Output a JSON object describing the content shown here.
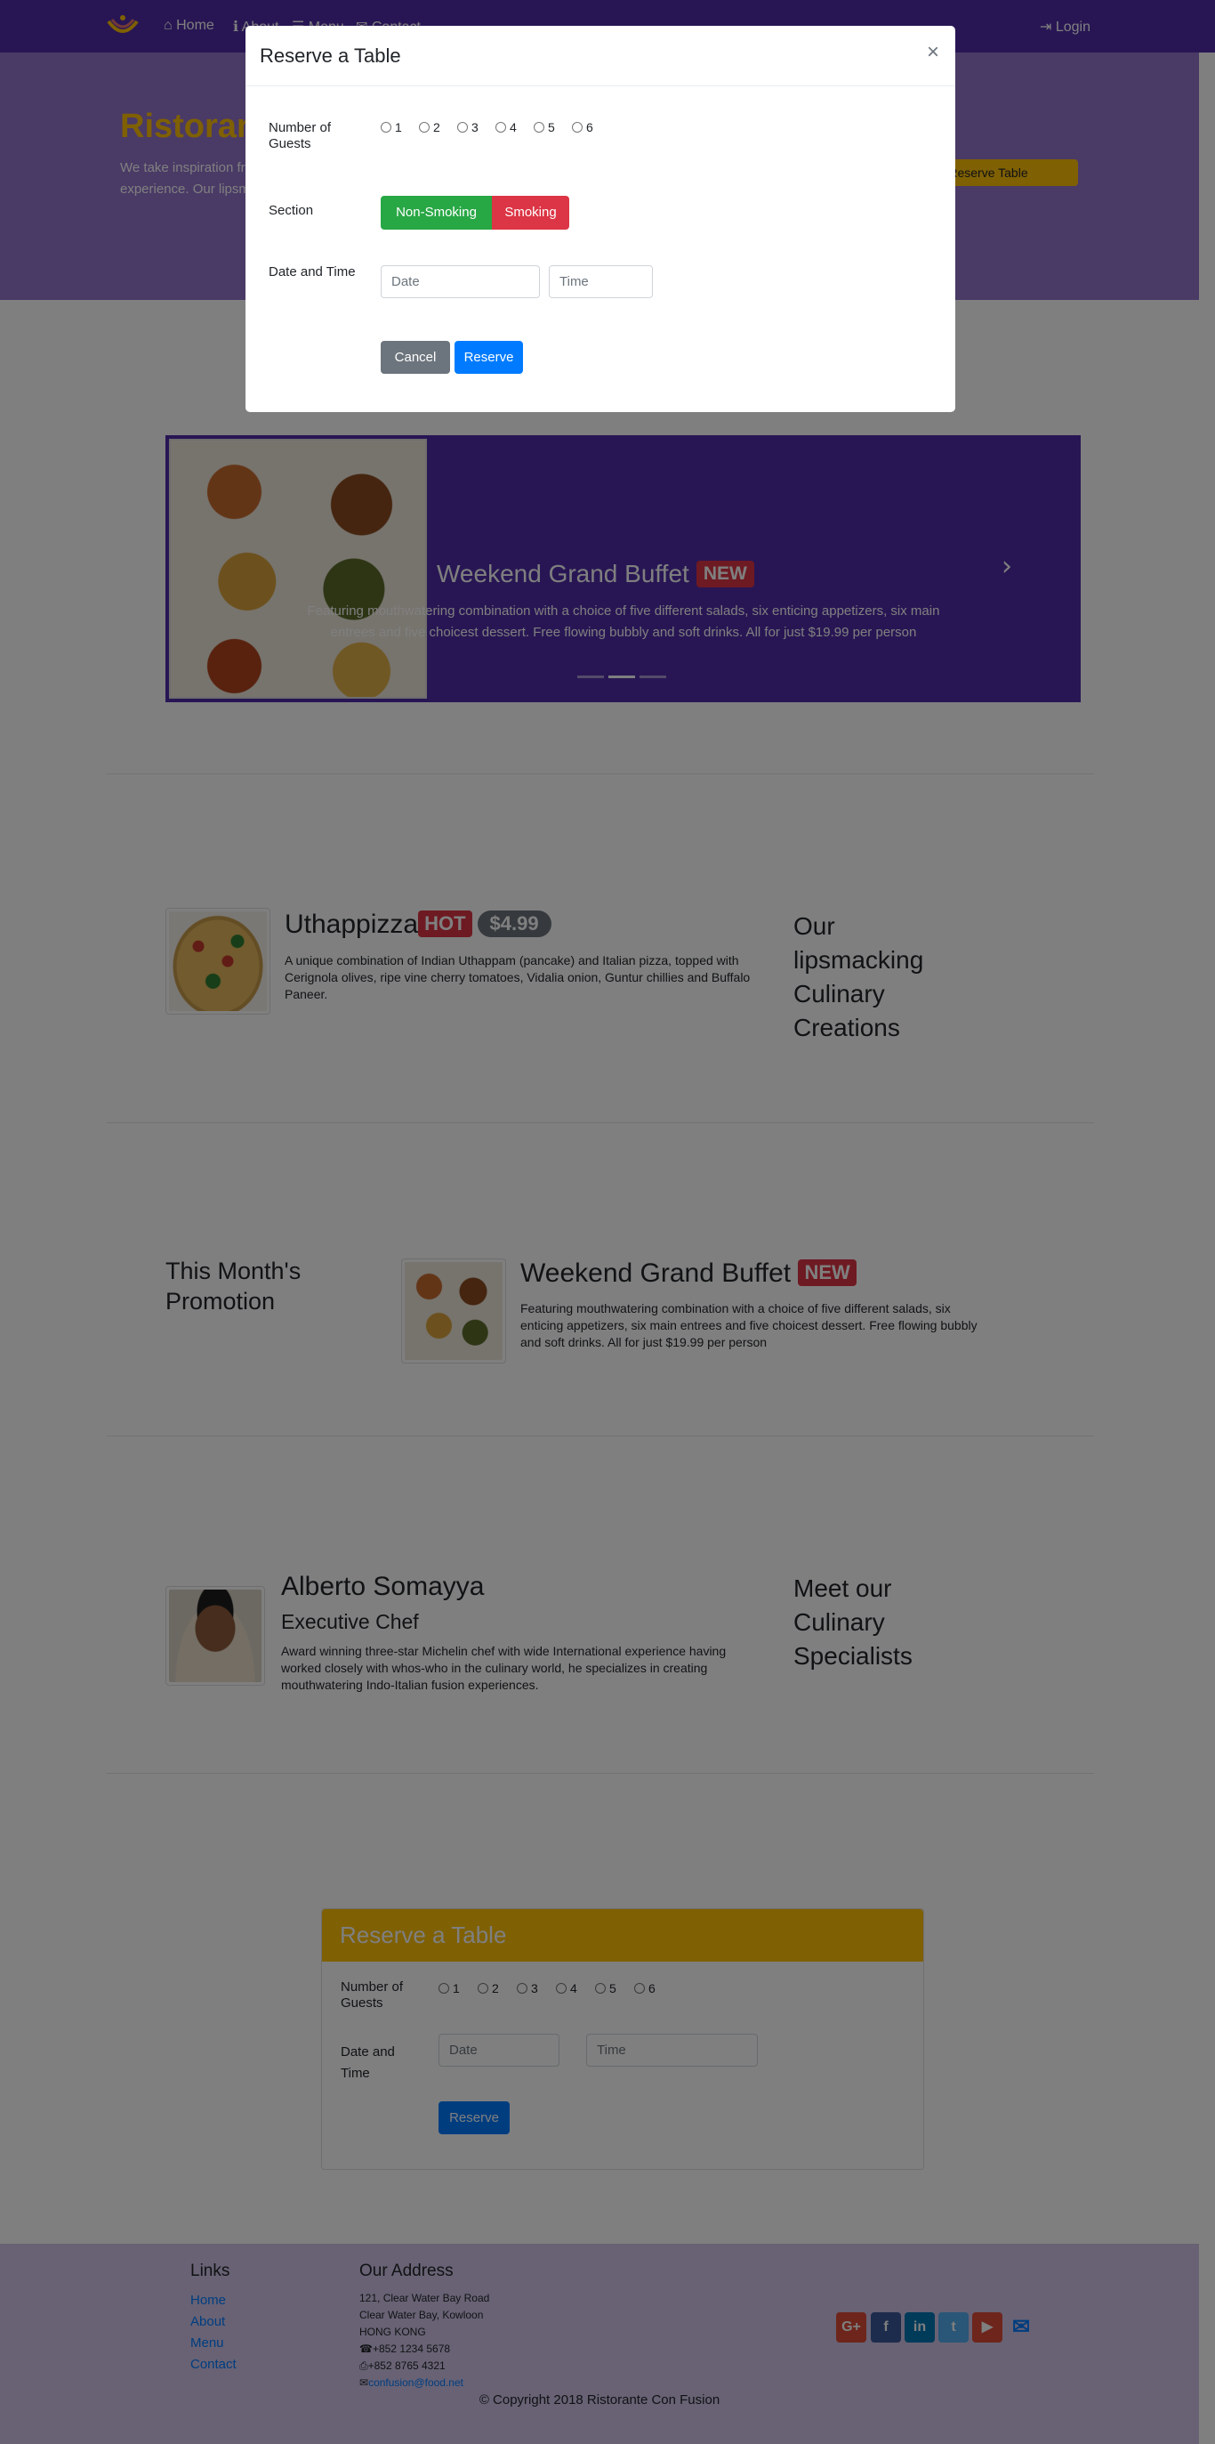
{
  "nav": {
    "home": "Home",
    "about": "About",
    "menu": "Menu",
    "contact": "Contact",
    "login": "Login"
  },
  "jumbotron": {
    "title": "Ristorante con Fusion",
    "text": "We take inspiration from the World's best cuisines, and create a unique fusion experience. Our lipsmacking creations will tickle your culinary senses!",
    "button": "Reserve Table"
  },
  "carousel": {
    "title": "Weekend Grand Buffet",
    "badge": "NEW",
    "text": "Featuring mouthwatering combination with a choice of five different salads, six enticing appetizers, six main entrees and five choicest dessert. Free flowing bubbly and soft drinks. All for just $19.99 per person"
  },
  "dish": {
    "title": "Uthappizza",
    "badge": "HOT",
    "price": "$4.99",
    "text": "A unique combination of Indian Uthappam (pancake) and Italian pizza, topped with Cerignola olives, ripe vine cherry tomatoes, Vidalia onion, Guntur chillies and Buffalo Paneer.",
    "side": "Our lipsmacking Culinary Creations"
  },
  "promotion": {
    "side": "This Month's Promotion",
    "title": "Weekend Grand Buffet",
    "badge": "NEW",
    "text": "Featuring mouthwatering combination with a choice of five different salads, six enticing appetizers, six main entrees and five choicest dessert. Free flowing bubbly and soft drinks. All for just $19.99 per person"
  },
  "chef": {
    "name": "Alberto Somayya",
    "role": "Executive Chef",
    "text": "Award winning three-star Michelin chef with wide International experience having worked closely with whos-who in the culinary world, he specializes in creating mouthwatering Indo-Italian fusion experiences.",
    "side": "Meet our Culinary Specialists"
  },
  "reserve_card": {
    "header": "Reserve a Table",
    "guests_label": "Number of Guests",
    "guest_options": [
      "1",
      "2",
      "3",
      "4",
      "5",
      "6"
    ],
    "datetime_label": "Date and Time",
    "date_placeholder": "Date",
    "time_placeholder": "Time",
    "submit": "Reserve"
  },
  "footer": {
    "links_title": "Links",
    "links": [
      "Home",
      "About",
      "Menu",
      "Contact"
    ],
    "address_title": "Our Address",
    "address_lines": [
      "121, Clear Water Bay Road",
      "Clear Water Bay, Kowloon",
      "HONG KONG"
    ],
    "phone": "+852 1234 5678",
    "fax": "+852 8765 4321",
    "email": "confusion@food.net",
    "social_icons": [
      "google-plus-icon",
      "facebook-icon",
      "linkedin-icon",
      "twitter-icon",
      "youtube-icon",
      "mail-icon"
    ],
    "copyright": "© Copyright 2018 Ristorante Con Fusion"
  },
  "modal": {
    "title": "Reserve a Table",
    "close": "×",
    "guests_label": "Number of Guests",
    "guest_options": [
      "1",
      "2",
      "3",
      "4",
      "5",
      "6"
    ],
    "section_label": "Section",
    "section_options": [
      "Non-Smoking",
      "Smoking"
    ],
    "datetime_label": "Date and Time",
    "date_placeholder": "Date",
    "time_placeholder": "Time",
    "cancel": "Cancel",
    "submit": "Reserve"
  },
  "colors": {
    "primary": "#512DA8",
    "jumbotron": "#9575CD",
    "accent": "#FFC107",
    "footer": "#D1C4E9",
    "badge": "#dc3545"
  }
}
